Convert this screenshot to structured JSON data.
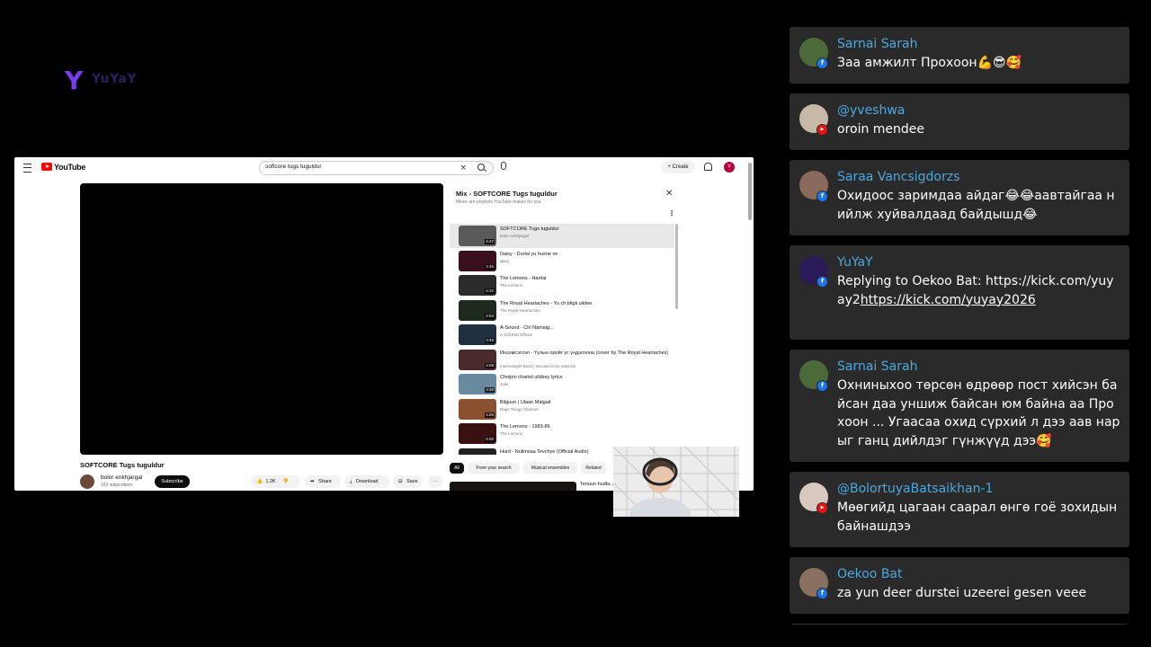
{
  "overlay": {
    "logo_text": "YuYaY"
  },
  "youtube": {
    "brand": "YouTube",
    "search_query": "softcore tugs tuguldur",
    "create_label": "Create",
    "avatar_letter": "Y",
    "video_title": "SOFTCORE Tugs tuguldur",
    "channel_name": "bolor enkhjargal",
    "channel_subs": "153 subscribers",
    "subscribe_label": "Subscribe",
    "like_count": "1.2K",
    "share_label": "Share",
    "download_label": "Download",
    "save_label": "Save",
    "more_label": "···",
    "mix": {
      "title": "Mix - SOFTCORE Tugs tuguldur",
      "subtitle": "Mixes are playlists YouTube makes for you",
      "items": [
        {
          "title": "SOFTCORE Tugs tuguldur",
          "channel": "bolor enkhjargal",
          "duration": "4:47",
          "thumb": "#5a5a5a"
        },
        {
          "title": "Daisy - Durlal yu husne ve",
          "channel": "Даку",
          "duration": "3:46",
          "thumb": "#3a1020"
        },
        {
          "title": "The Lemons - Hairtai",
          "channel": "The Lemons",
          "duration": "4:22",
          "thumb": "#2b2b2b"
        },
        {
          "title": "The Royal Heartaches - Yu ch bitgii uildee",
          "channel": "The Royal Heartaches",
          "duration": "3:53",
          "thumb": "#1f2a1f"
        },
        {
          "title": "A-Sound - Chi Namaig...",
          "channel": "A-SOUND Official",
          "duration": "3:49",
          "thumb": "#203040"
        },
        {
          "title": "Инээмсэглэл - Үүлын оройг ус үндэлэлна (cover by The Royal Heartaches)",
          "channel": "Ineemseglel Band | Инээмсэглэл хамтлаг",
          "duration": "4:09",
          "thumb": "#4a2a2a"
        },
        {
          "title": "Choijoo chamd uildsey lyrics",
          "channel": "Jolie",
          "duration": "4:48",
          "thumb": "#6a8aa0"
        },
        {
          "title": "Bilguun | Ulaan Malgait",
          "channel": "Rags Tsingy Channel",
          "duration": "4:25",
          "thumb": "#8a5030"
        },
        {
          "title": "The Lemons - 1983-86",
          "channel": "The Lemons",
          "duration": "5:00",
          "thumb": "#3a1010"
        },
        {
          "title": "Hurd - Nulimsaa Tevchye (Official Audio)",
          "channel": "",
          "duration": "",
          "thumb": "#222"
        }
      ]
    },
    "chips": [
      "All",
      "From your search",
      "Musical ensembles",
      "Related"
    ],
    "related_title": "Tenuun hudla..."
  },
  "chat": {
    "messages": [
      {
        "user": "Sarnai Sarah",
        "platform": "facebook",
        "text": "Заа амжилт Прохоон💪😎🥰",
        "avatar_color": "#4a6a3a"
      },
      {
        "user": "@yveshwa",
        "platform": "youtube",
        "text": "oroin mendee",
        "avatar_color": "#c8b8a8"
      },
      {
        "user": "Saraa Vancsigdorzs",
        "platform": "facebook",
        "text": "Охидоос заримдаа айдаг😂😂аавтайгаа нийлж хуйвалдаад байдышд😂",
        "avatar_color": "#8a6a5a"
      },
      {
        "user": "YuYaY",
        "platform": "facebook",
        "text_plain": "Replying to Oekoo Bat: https://kick.com/yuyay2",
        "text_link": "https://kick.com/yuyay2026",
        "avatar_color": "#2a1a5a"
      },
      {
        "user": "Sarnai Sarah",
        "platform": "facebook",
        "text": "Охниныхоо төрсөн өдрөөр пост хийсэн байсан даа уншиж байсан юм байна аа Прохоон ... Угаасаа охид сүрхий л дээ аав нарыг ганц дийлдэг гүнжүүд дээ🥰",
        "avatar_color": "#4a6a3a"
      },
      {
        "user": "@BolortuyaBatsaikhan-1",
        "platform": "youtube",
        "text": "Мөөгийд цагаан саарал өнгө гоё зохидын байнашдээ",
        "avatar_color": "#d8c8c0"
      },
      {
        "user": "Oekoo Bat",
        "platform": "facebook",
        "text": "za yun deer durstei uzeerei gesen veee",
        "avatar_color": "#8a7060"
      }
    ]
  }
}
